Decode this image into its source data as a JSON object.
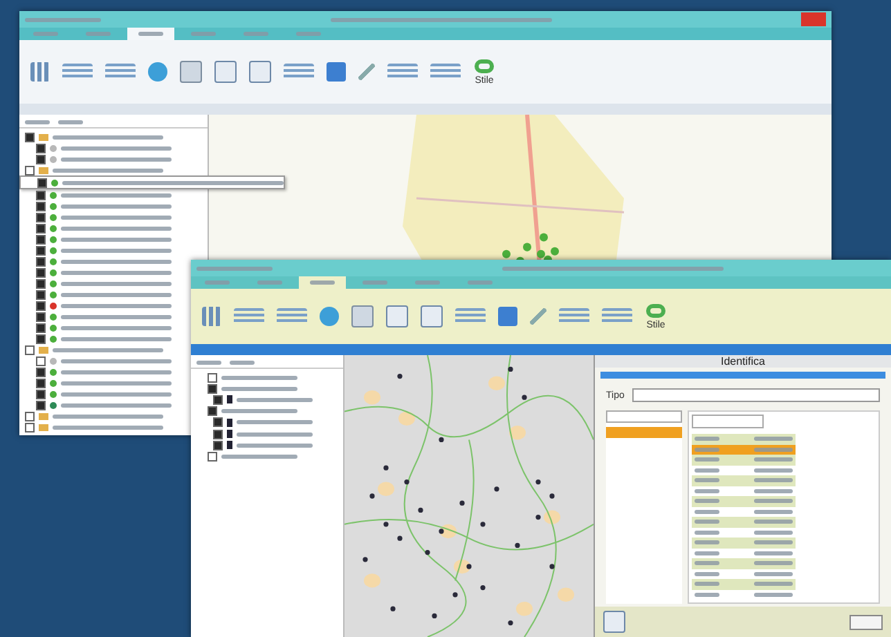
{
  "back_window": {
    "ribbon_tabs": [
      {
        "selected": false
      },
      {
        "selected": false
      },
      {
        "selected": true
      },
      {
        "selected": false
      },
      {
        "selected": false
      },
      {
        "selected": false
      }
    ],
    "style_button": "Stile",
    "layers": [
      {
        "kind": "group",
        "checked": true,
        "selected": false
      },
      {
        "kind": "layer",
        "checked": true,
        "selected": false,
        "color": "#b8b8b8"
      },
      {
        "kind": "layer",
        "checked": true,
        "selected": false,
        "color": "#b8b8b8"
      },
      {
        "kind": "group",
        "checked": false,
        "selected": false
      },
      {
        "kind": "layer",
        "checked": true,
        "selected": true,
        "color": "#4caf3c"
      },
      {
        "kind": "layer",
        "checked": true,
        "selected": false,
        "color": "#4caf3c"
      },
      {
        "kind": "layer",
        "checked": true,
        "selected": false,
        "color": "#4caf3c"
      },
      {
        "kind": "layer",
        "checked": true,
        "selected": false,
        "color": "#4caf3c"
      },
      {
        "kind": "layer",
        "checked": true,
        "selected": false,
        "color": "#4caf3c"
      },
      {
        "kind": "layer",
        "checked": true,
        "selected": false,
        "color": "#4caf3c"
      },
      {
        "kind": "layer",
        "checked": true,
        "selected": false,
        "color": "#4caf3c"
      },
      {
        "kind": "layer",
        "checked": true,
        "selected": false,
        "color": "#4caf3c"
      },
      {
        "kind": "layer",
        "checked": true,
        "selected": false,
        "color": "#4caf3c"
      },
      {
        "kind": "layer",
        "checked": true,
        "selected": false,
        "color": "#4caf3c"
      },
      {
        "kind": "layer",
        "checked": true,
        "selected": false,
        "color": "#4caf3c"
      },
      {
        "kind": "layer",
        "checked": true,
        "selected": false,
        "color": "#d9342b"
      },
      {
        "kind": "layer",
        "checked": true,
        "selected": false,
        "color": "#4caf3c"
      },
      {
        "kind": "layer",
        "checked": true,
        "selected": false,
        "color": "#4caf3c"
      },
      {
        "kind": "layer",
        "checked": true,
        "selected": false,
        "color": "#4caf3c"
      },
      {
        "kind": "group",
        "checked": false,
        "selected": false
      },
      {
        "kind": "layer",
        "checked": false,
        "selected": false,
        "color": "#b8b8b8"
      },
      {
        "kind": "layer",
        "checked": true,
        "selected": false,
        "color": "#4caf3c"
      },
      {
        "kind": "layer",
        "checked": true,
        "selected": false,
        "color": "#4caf3c"
      },
      {
        "kind": "layer",
        "checked": true,
        "selected": false,
        "color": "#4caf3c"
      },
      {
        "kind": "layer",
        "checked": true,
        "selected": false,
        "color": "#2e8b57"
      },
      {
        "kind": "group",
        "checked": false,
        "selected": false
      },
      {
        "kind": "group",
        "checked": false,
        "selected": false
      }
    ]
  },
  "front_window": {
    "ribbon_tabs": [
      {
        "selected": false
      },
      {
        "selected": false
      },
      {
        "selected": true
      },
      {
        "selected": false
      },
      {
        "selected": false
      },
      {
        "selected": false
      }
    ],
    "style_button": "Stile",
    "layers": [
      {
        "kind": "group",
        "checked": false
      },
      {
        "kind": "group",
        "checked": true
      },
      {
        "kind": "layer",
        "checked": true
      },
      {
        "kind": "group",
        "checked": true
      },
      {
        "kind": "layer",
        "checked": true
      },
      {
        "kind": "layer",
        "checked": true
      },
      {
        "kind": "layer",
        "checked": true
      },
      {
        "kind": "group",
        "checked": false
      }
    ],
    "dialog": {
      "title": "Identifica",
      "type_label": "Tipo",
      "features": [
        {
          "selected": true
        }
      ],
      "attribute_rows": [
        {
          "selected": false
        },
        {
          "selected": true
        },
        {
          "selected": false
        },
        {
          "selected": false
        },
        {
          "selected": false
        },
        {
          "selected": false
        },
        {
          "selected": false
        },
        {
          "selected": false
        },
        {
          "selected": false
        },
        {
          "selected": false
        },
        {
          "selected": false
        },
        {
          "selected": false
        },
        {
          "selected": false
        },
        {
          "selected": false
        },
        {
          "selected": false
        },
        {
          "selected": false
        }
      ]
    }
  }
}
